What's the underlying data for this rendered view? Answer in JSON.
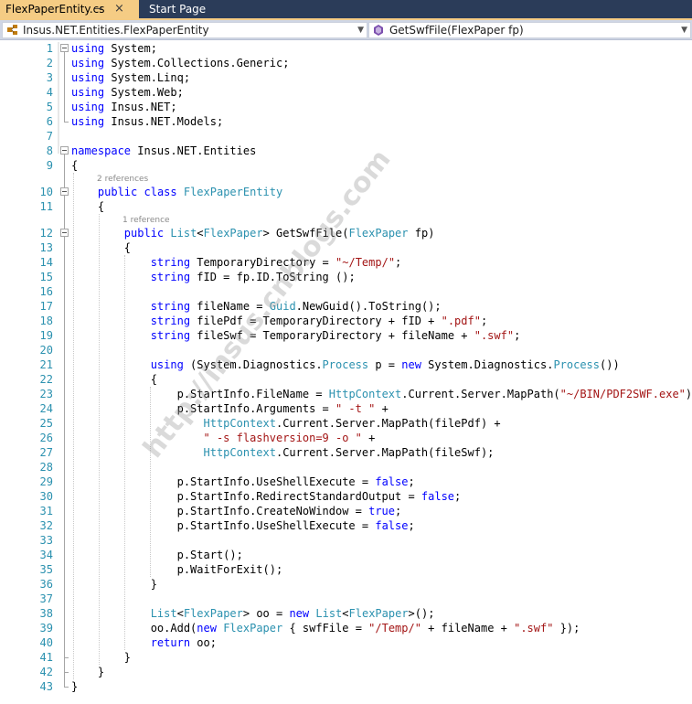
{
  "tabs": [
    {
      "label": "FlexPaperEntity.cs",
      "pin": "⊸",
      "close": "×"
    },
    {
      "label": "Start Page"
    }
  ],
  "nav": {
    "class_scope": "Insus.NET.Entities.FlexPaperEntity",
    "member": "GetSwfFile(FlexPaper fp)"
  },
  "watermark": "http://insus.cnblogs.com",
  "lines": [
    {
      "n": "1",
      "code": [
        {
          "t": "using",
          "c": "kw"
        },
        {
          "t": " System;"
        }
      ]
    },
    {
      "n": "2",
      "code": [
        {
          "t": "using",
          "c": "kw"
        },
        {
          "t": " System.Collections.Generic;"
        }
      ]
    },
    {
      "n": "3",
      "code": [
        {
          "t": "using",
          "c": "kw"
        },
        {
          "t": " System.Linq;"
        }
      ]
    },
    {
      "n": "4",
      "code": [
        {
          "t": "using",
          "c": "kw"
        },
        {
          "t": " System.Web;"
        }
      ]
    },
    {
      "n": "5",
      "code": [
        {
          "t": "using",
          "c": "kw"
        },
        {
          "t": " Insus.NET;"
        }
      ]
    },
    {
      "n": "6",
      "code": [
        {
          "t": "using",
          "c": "kw"
        },
        {
          "t": " Insus.NET.Models;"
        }
      ]
    },
    {
      "n": "7",
      "code": []
    },
    {
      "n": "8",
      "code": [
        {
          "t": "namespace",
          "c": "kw"
        },
        {
          "t": " Insus.NET.Entities"
        }
      ]
    },
    {
      "n": "9",
      "code": [
        {
          "t": "{"
        }
      ]
    },
    {
      "n": "",
      "lens": "2 references",
      "indent": 4
    },
    {
      "n": "10",
      "code": [
        {
          "t": "    "
        },
        {
          "t": "public",
          "c": "kw"
        },
        {
          "t": " "
        },
        {
          "t": "class",
          "c": "kw"
        },
        {
          "t": " "
        },
        {
          "t": "FlexPaperEntity",
          "c": "ty"
        }
      ]
    },
    {
      "n": "11",
      "code": [
        {
          "t": "    {"
        }
      ]
    },
    {
      "n": "",
      "lens": "1 reference",
      "indent": 8
    },
    {
      "n": "12",
      "code": [
        {
          "t": "        "
        },
        {
          "t": "public",
          "c": "kw"
        },
        {
          "t": " "
        },
        {
          "t": "List",
          "c": "ty"
        },
        {
          "t": "<"
        },
        {
          "t": "FlexPaper",
          "c": "ty"
        },
        {
          "t": "> GetSwfFile("
        },
        {
          "t": "FlexPaper",
          "c": "ty"
        },
        {
          "t": " fp)"
        }
      ]
    },
    {
      "n": "13",
      "code": [
        {
          "t": "        {"
        }
      ]
    },
    {
      "n": "14",
      "code": [
        {
          "t": "            "
        },
        {
          "t": "string",
          "c": "kw"
        },
        {
          "t": " TemporaryDirectory = "
        },
        {
          "t": "\"~/Temp/\"",
          "c": "st"
        },
        {
          "t": ";"
        }
      ]
    },
    {
      "n": "15",
      "code": [
        {
          "t": "            "
        },
        {
          "t": "string",
          "c": "kw"
        },
        {
          "t": " fID = fp.ID.ToString ();"
        }
      ]
    },
    {
      "n": "16",
      "code": []
    },
    {
      "n": "17",
      "code": [
        {
          "t": "            "
        },
        {
          "t": "string",
          "c": "kw"
        },
        {
          "t": " fileName = "
        },
        {
          "t": "Guid",
          "c": "ty"
        },
        {
          "t": ".NewGuid().ToString();"
        }
      ]
    },
    {
      "n": "18",
      "code": [
        {
          "t": "            "
        },
        {
          "t": "string",
          "c": "kw"
        },
        {
          "t": " filePdf = TemporaryDirectory + fID + "
        },
        {
          "t": "\".pdf\"",
          "c": "st"
        },
        {
          "t": ";"
        }
      ]
    },
    {
      "n": "19",
      "code": [
        {
          "t": "            "
        },
        {
          "t": "string",
          "c": "kw"
        },
        {
          "t": " fileSwf = TemporaryDirectory + fileName + "
        },
        {
          "t": "\".swf\"",
          "c": "st"
        },
        {
          "t": ";"
        }
      ]
    },
    {
      "n": "20",
      "code": []
    },
    {
      "n": "21",
      "code": [
        {
          "t": "            "
        },
        {
          "t": "using",
          "c": "kw"
        },
        {
          "t": " (System.Diagnostics."
        },
        {
          "t": "Process",
          "c": "ty"
        },
        {
          "t": " p = "
        },
        {
          "t": "new",
          "c": "kw"
        },
        {
          "t": " System.Diagnostics."
        },
        {
          "t": "Process",
          "c": "ty"
        },
        {
          "t": "())"
        }
      ]
    },
    {
      "n": "22",
      "code": [
        {
          "t": "            {"
        }
      ]
    },
    {
      "n": "23",
      "code": [
        {
          "t": "                p.StartInfo.FileName = "
        },
        {
          "t": "HttpContext",
          "c": "ty"
        },
        {
          "t": ".Current.Server.MapPath("
        },
        {
          "t": "\"~/BIN/PDF2SWF.exe\"",
          "c": "st"
        },
        {
          "t": ");"
        }
      ]
    },
    {
      "n": "24",
      "code": [
        {
          "t": "                p.StartInfo.Arguments = "
        },
        {
          "t": "\" -t \"",
          "c": "st"
        },
        {
          "t": " +"
        }
      ]
    },
    {
      "n": "25",
      "code": [
        {
          "t": "                    "
        },
        {
          "t": "HttpContext",
          "c": "ty"
        },
        {
          "t": ".Current.Server.MapPath(filePdf) +"
        }
      ]
    },
    {
      "n": "26",
      "code": [
        {
          "t": "                    "
        },
        {
          "t": "\" -s flashversion=9 -o \"",
          "c": "st"
        },
        {
          "t": " +"
        }
      ]
    },
    {
      "n": "27",
      "code": [
        {
          "t": "                    "
        },
        {
          "t": "HttpContext",
          "c": "ty"
        },
        {
          "t": ".Current.Server.MapPath(fileSwf);"
        }
      ]
    },
    {
      "n": "28",
      "code": []
    },
    {
      "n": "29",
      "code": [
        {
          "t": "                p.StartInfo.UseShellExecute = "
        },
        {
          "t": "false",
          "c": "kw"
        },
        {
          "t": ";"
        }
      ]
    },
    {
      "n": "30",
      "code": [
        {
          "t": "                p.StartInfo.RedirectStandardOutput = "
        },
        {
          "t": "false",
          "c": "kw"
        },
        {
          "t": ";"
        }
      ]
    },
    {
      "n": "31",
      "code": [
        {
          "t": "                p.StartInfo.CreateNoWindow = "
        },
        {
          "t": "true",
          "c": "kw"
        },
        {
          "t": ";"
        }
      ]
    },
    {
      "n": "32",
      "code": [
        {
          "t": "                p.StartInfo.UseShellExecute = "
        },
        {
          "t": "false",
          "c": "kw"
        },
        {
          "t": ";"
        }
      ]
    },
    {
      "n": "33",
      "code": []
    },
    {
      "n": "34",
      "code": [
        {
          "t": "                p.Start();"
        }
      ]
    },
    {
      "n": "35",
      "code": [
        {
          "t": "                p.WaitForExit();"
        }
      ]
    },
    {
      "n": "36",
      "code": [
        {
          "t": "            }"
        }
      ]
    },
    {
      "n": "37",
      "code": []
    },
    {
      "n": "38",
      "code": [
        {
          "t": "            "
        },
        {
          "t": "List",
          "c": "ty"
        },
        {
          "t": "<"
        },
        {
          "t": "FlexPaper",
          "c": "ty"
        },
        {
          "t": "> oo = "
        },
        {
          "t": "new",
          "c": "kw"
        },
        {
          "t": " "
        },
        {
          "t": "List",
          "c": "ty"
        },
        {
          "t": "<"
        },
        {
          "t": "FlexPaper",
          "c": "ty"
        },
        {
          "t": ">();"
        }
      ]
    },
    {
      "n": "39",
      "code": [
        {
          "t": "            oo.Add("
        },
        {
          "t": "new",
          "c": "kw"
        },
        {
          "t": " "
        },
        {
          "t": "FlexPaper",
          "c": "ty"
        },
        {
          "t": " { swfFile = "
        },
        {
          "t": "\"/Temp/\"",
          "c": "st"
        },
        {
          "t": " + fileName + "
        },
        {
          "t": "\".swf\"",
          "c": "st"
        },
        {
          "t": " });"
        }
      ]
    },
    {
      "n": "40",
      "code": [
        {
          "t": "            "
        },
        {
          "t": "return",
          "c": "kw"
        },
        {
          "t": " oo;"
        }
      ]
    },
    {
      "n": "41",
      "code": [
        {
          "t": "        }"
        }
      ]
    },
    {
      "n": "42",
      "code": [
        {
          "t": "    }"
        }
      ]
    },
    {
      "n": "43",
      "code": [
        {
          "t": "}"
        }
      ]
    }
  ]
}
